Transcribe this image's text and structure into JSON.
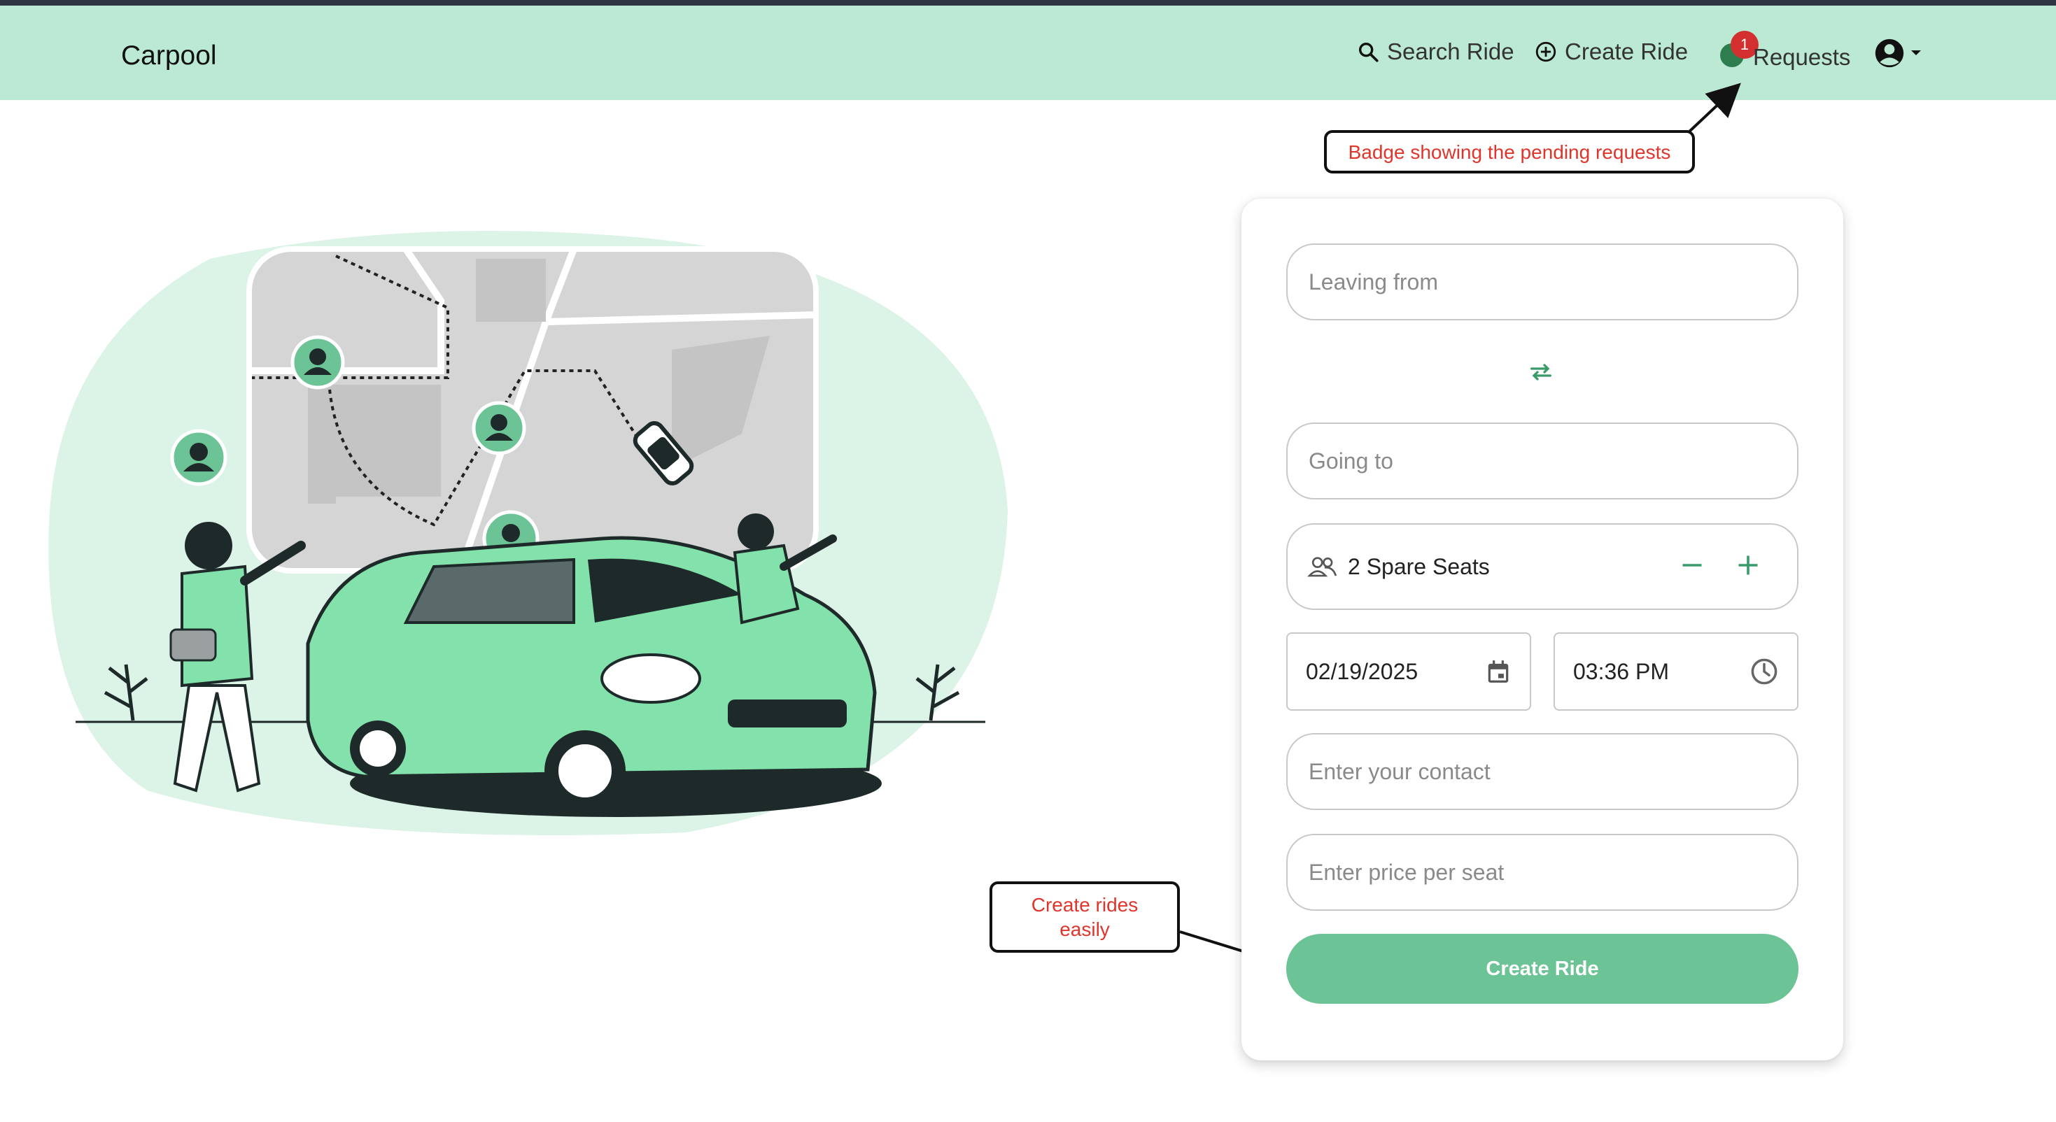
{
  "navbar": {
    "brand": "Carpool",
    "search_ride": "Search Ride",
    "create_ride": "Create Ride",
    "requests": "Requests",
    "requests_badge": "1"
  },
  "annotations": {
    "badge_note": "Badge showing the pending requests",
    "create_note": "Create rides easily"
  },
  "form": {
    "leaving_from_placeholder": "Leaving from",
    "going_to_placeholder": "Going to",
    "seats_label": "2 Spare Seats",
    "date_value": "02/19/2025",
    "time_value": "03:36 PM",
    "contact_placeholder": "Enter your contact",
    "price_placeholder": "Enter price per seat",
    "submit_label": "Create Ride"
  },
  "colors": {
    "navbar_bg": "#bbe9d3",
    "accent_green": "#6cc395",
    "badge_red": "#d32f2f",
    "annotation_red": "#e0352b"
  },
  "icons": [
    "search-icon",
    "add-circle-icon",
    "requests-icon",
    "user-avatar-icon",
    "caret-down-icon",
    "swap-icon",
    "people-icon",
    "minus-icon",
    "plus-icon",
    "calendar-icon",
    "clock-icon"
  ]
}
